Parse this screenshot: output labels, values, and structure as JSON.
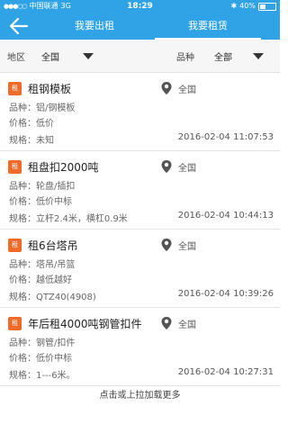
{
  "status_bar": {
    "carrier": "中国联通",
    "network": "3G",
    "time": "18:29",
    "battery": "40%"
  },
  "nav": {
    "tabs": [
      {
        "label": "我要出租",
        "active": false
      },
      {
        "label": "我要租赁",
        "active": true
      }
    ]
  },
  "filter": {
    "region_label": "地区",
    "region_value": "全国",
    "type_label": "品种",
    "type_value": "全部"
  },
  "labels": {
    "type": "品种：",
    "price": "价格：",
    "spec": "规格："
  },
  "items": [
    {
      "title": "租钢模板",
      "location": "全国",
      "type": "铝/钢模板",
      "price": "低价",
      "spec": "未知",
      "date": "2016-02-04 11:07:53"
    },
    {
      "title": "租盘扣2000吨",
      "location": "全国",
      "type": "轮盘/插扣",
      "price": "低价中标",
      "spec": "立杆2.4米，横杠0.9米",
      "date": "2016-02-04 10:44:13"
    },
    {
      "title": "租6台塔吊",
      "location": "全国",
      "type": "塔吊/吊篮",
      "price": "越低越好",
      "spec": "QTZ40(4908)",
      "date": "2016-02-04 10:39:26"
    },
    {
      "title": "年后租4000吨钢管扣件",
      "location": "全国",
      "type": "钢管/扣件",
      "price": "低价中标",
      "spec": "1---6米。",
      "date": "2016-02-04 10:27:31"
    }
  ],
  "load_more": "点击或上拉加载更多",
  "colors": {
    "brand_blue": "#2fa3e6",
    "rent_badge": "#f06b2a"
  },
  "icons": {
    "back": "arrow-left-icon",
    "location": "map-pin-icon",
    "badge": "rent-badge-icon",
    "dropdown": "triangle-down-icon"
  }
}
